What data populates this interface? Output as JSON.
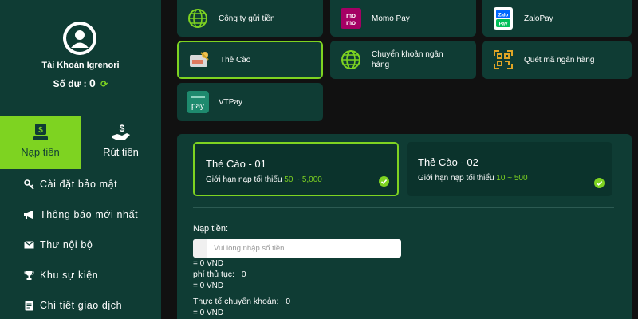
{
  "sidebar": {
    "account_name": "Tài Khoản Igrenori",
    "balance_label": "Số dư :",
    "balance_value": "0",
    "tabs": [
      {
        "label": "Nạp tiền",
        "icon": "deposit-money-icon",
        "active": true
      },
      {
        "label": "Rút tiền",
        "icon": "withdraw-money-icon",
        "active": false
      }
    ],
    "menu": [
      {
        "label": "Cài đặt bảo mật",
        "icon": "key-icon"
      },
      {
        "label": "Thông báo mới nhất",
        "icon": "megaphone-icon"
      },
      {
        "label": "Thư nội bộ",
        "icon": "envelope-icon"
      },
      {
        "label": "Khu sự kiện",
        "icon": "trophy-icon"
      },
      {
        "label": "Chi tiết giao dịch",
        "icon": "receipt-icon"
      }
    ]
  },
  "methods": [
    {
      "label": "Công ty gửi tiền",
      "icon": "globe-icon"
    },
    {
      "label": "Momo Pay",
      "icon": "momo-logo-icon",
      "logo_text": "mo mo"
    },
    {
      "label": "ZaloPay",
      "icon": "zalopay-logo-icon",
      "logo_text": "Zalo Pay"
    },
    {
      "label": "Thẻ Cào",
      "icon": "scratch-card-icon",
      "selected": true
    },
    {
      "label": "Chuyển khoản ngân hàng",
      "icon": "globe-icon"
    },
    {
      "label": "Quét mã ngân hàng",
      "icon": "qr-code-icon"
    },
    {
      "label": "VTPay",
      "icon": "vtpay-logo-icon",
      "logo_text": "pay"
    }
  ],
  "card_options": [
    {
      "title": "Thẻ Cào - 01",
      "limit_label": "Giới hạn nạp tối thiểu",
      "range": "50 ~ 5,000",
      "selected": true
    },
    {
      "title": "Thẻ Cào - 02",
      "limit_label": "Giới hạn nạp tối thiểu",
      "range": "10 ~ 500",
      "selected": false
    }
  ],
  "form": {
    "deposit_label": "Nạp tiền:",
    "amount_placeholder": "Vui lòng nhập số tiền",
    "amount_vnd": "= 0 VND",
    "fee_label": "phí thủ tục:",
    "fee_value": "0",
    "fee_vnd": "= 0 VND",
    "actual_label": "Thực tế chuyển khoản:",
    "actual_value": "0",
    "actual_vnd": "= 0 VND"
  },
  "colors": {
    "accent": "#7ed321",
    "panel": "#0f3c34",
    "background": "#111111"
  }
}
